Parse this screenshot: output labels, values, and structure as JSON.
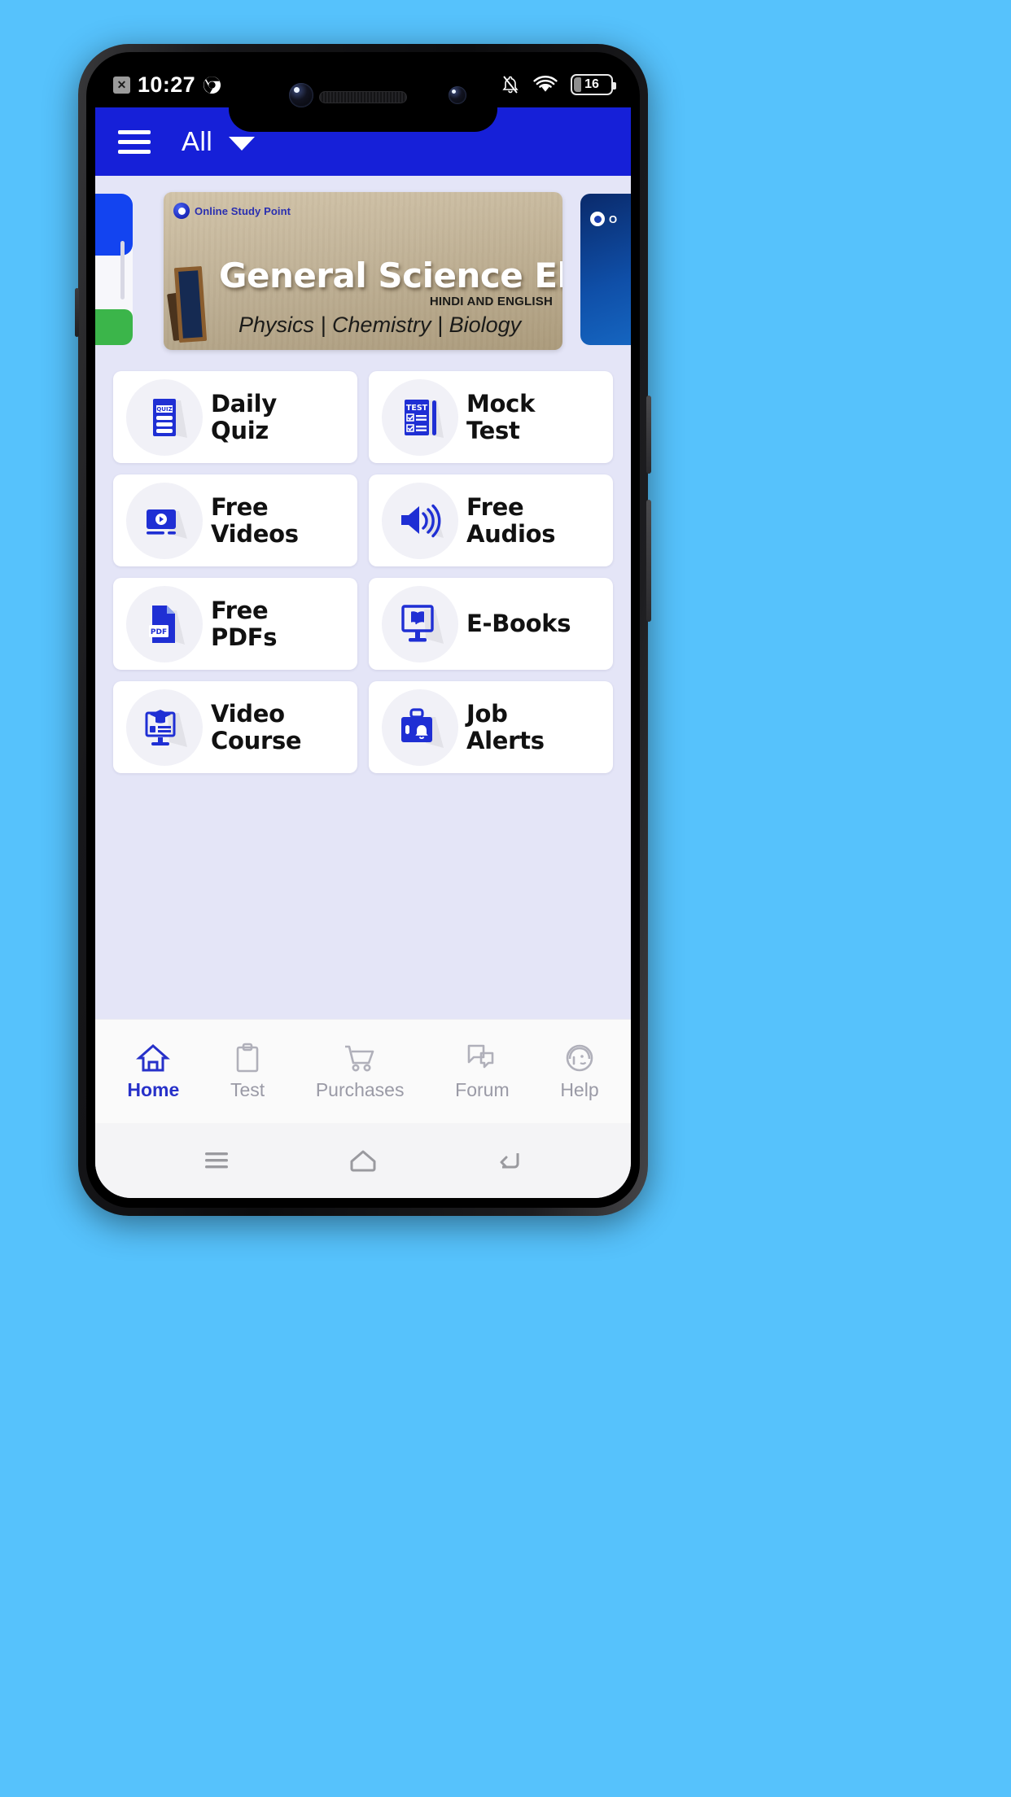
{
  "status_bar": {
    "x_badge_icon": "x-badge-icon",
    "time": "10:27",
    "chrome_icon": "chrome-icon",
    "silent_icon": "bell-off-icon",
    "wifi_icon": "wifi-icon",
    "battery_icon": "battery-icon",
    "battery_level": "16"
  },
  "appbar": {
    "menu_icon": "hamburger-menu-icon",
    "title": "All",
    "dropdown_icon": "chevron-down-icon",
    "background_color": "#1620d8"
  },
  "carousel": {
    "current_slide": {
      "logo_text": "Online Study Point",
      "title": "General Science Ebooks",
      "subtitle": "HINDI AND ENGLISH",
      "line3": "Physics | Chemistry | Biology"
    },
    "next_slide": {
      "logo_text": "O"
    }
  },
  "grid": {
    "tiles": [
      {
        "label_line1": "Daily",
        "label_line2": "Quiz",
        "icon": "quiz-document-icon"
      },
      {
        "label_line1": "Mock",
        "label_line2": "Test",
        "icon": "test-checklist-icon"
      },
      {
        "label_line1": "Free",
        "label_line2": "Videos",
        "icon": "video-player-icon"
      },
      {
        "label_line1": "Free",
        "label_line2": "Audios",
        "icon": "speaker-icon"
      },
      {
        "label_line1": "Free",
        "label_line2": "PDFs",
        "icon": "pdf-file-icon"
      },
      {
        "label_line1": "E-Books",
        "label_line2": "",
        "icon": "monitor-book-icon"
      },
      {
        "label_line1": "Video",
        "label_line2": "Course",
        "icon": "graduation-monitor-icon"
      },
      {
        "label_line1": "Job",
        "label_line2": "Alerts",
        "icon": "briefcase-bell-icon"
      }
    ]
  },
  "bottom_nav": {
    "active_color": "#2731c9",
    "inactive_color": "#9a9aa6",
    "items": [
      {
        "label": "Home",
        "icon": "home-icon",
        "active": true
      },
      {
        "label": "Test",
        "icon": "clipboard-icon",
        "active": false
      },
      {
        "label": "Purchases",
        "icon": "cart-icon",
        "active": false
      },
      {
        "label": "Forum",
        "icon": "chat-icon",
        "active": false
      },
      {
        "label": "Help",
        "icon": "headset-icon",
        "active": false
      }
    ]
  },
  "android_nav": {
    "recents_icon": "recents-icon",
    "home_icon": "home-outline-icon",
    "back_icon": "back-icon"
  }
}
